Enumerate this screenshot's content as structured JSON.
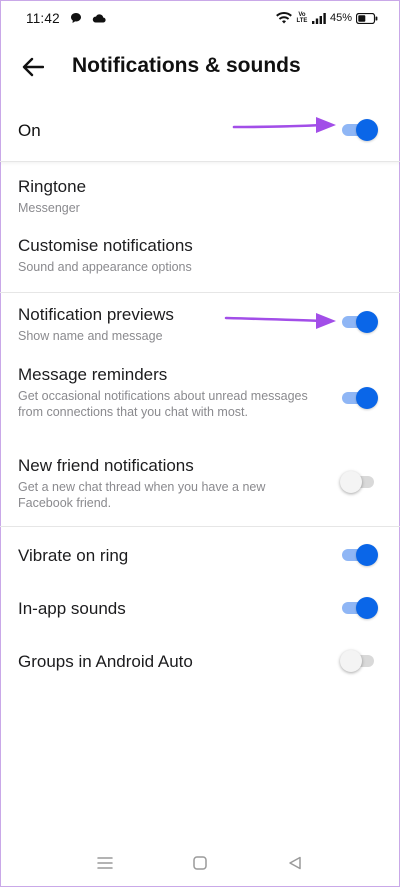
{
  "status_bar": {
    "time": "11:42",
    "battery_percent": "45%",
    "icons": [
      "chat-bubble-icon",
      "cloud-icon",
      "wifi-icon",
      "volte-icon",
      "signal-icon",
      "battery-icon"
    ],
    "volte_label": "Vo LTE"
  },
  "header": {
    "title": "Notifications & sounds",
    "back_icon": "back-arrow-icon"
  },
  "master": {
    "label": "On",
    "enabled": true
  },
  "sections": [
    {
      "items": [
        {
          "title": "Ringtone",
          "subtitle": "Messenger"
        },
        {
          "title": "Customise notifications",
          "subtitle": "Sound and appearance options"
        }
      ]
    },
    {
      "items": [
        {
          "title": "Notification previews",
          "subtitle": "Show name and message",
          "enabled": true
        },
        {
          "title": "Message reminders",
          "subtitle": "Get occasional notifications about unread messages from connections that you chat with most.",
          "enabled": true
        },
        {
          "title": "New friend notifications",
          "subtitle": "Get a new chat thread when you have a new Facebook friend.",
          "enabled": false
        }
      ]
    },
    {
      "items": [
        {
          "title": "Vibrate on ring",
          "enabled": true
        },
        {
          "title": "In-app sounds",
          "enabled": true
        },
        {
          "title": "Groups in Android Auto",
          "enabled": false
        }
      ]
    }
  ],
  "colors": {
    "toggle_on_knob": "#0a66e8",
    "toggle_on_track": "#8fb6f5",
    "toggle_off_track": "#d9d9d9",
    "annotation_arrow": "#a24ee8"
  },
  "nav_bar": {
    "icons": [
      "menu-icon",
      "home-square-icon",
      "back-triangle-icon"
    ]
  }
}
